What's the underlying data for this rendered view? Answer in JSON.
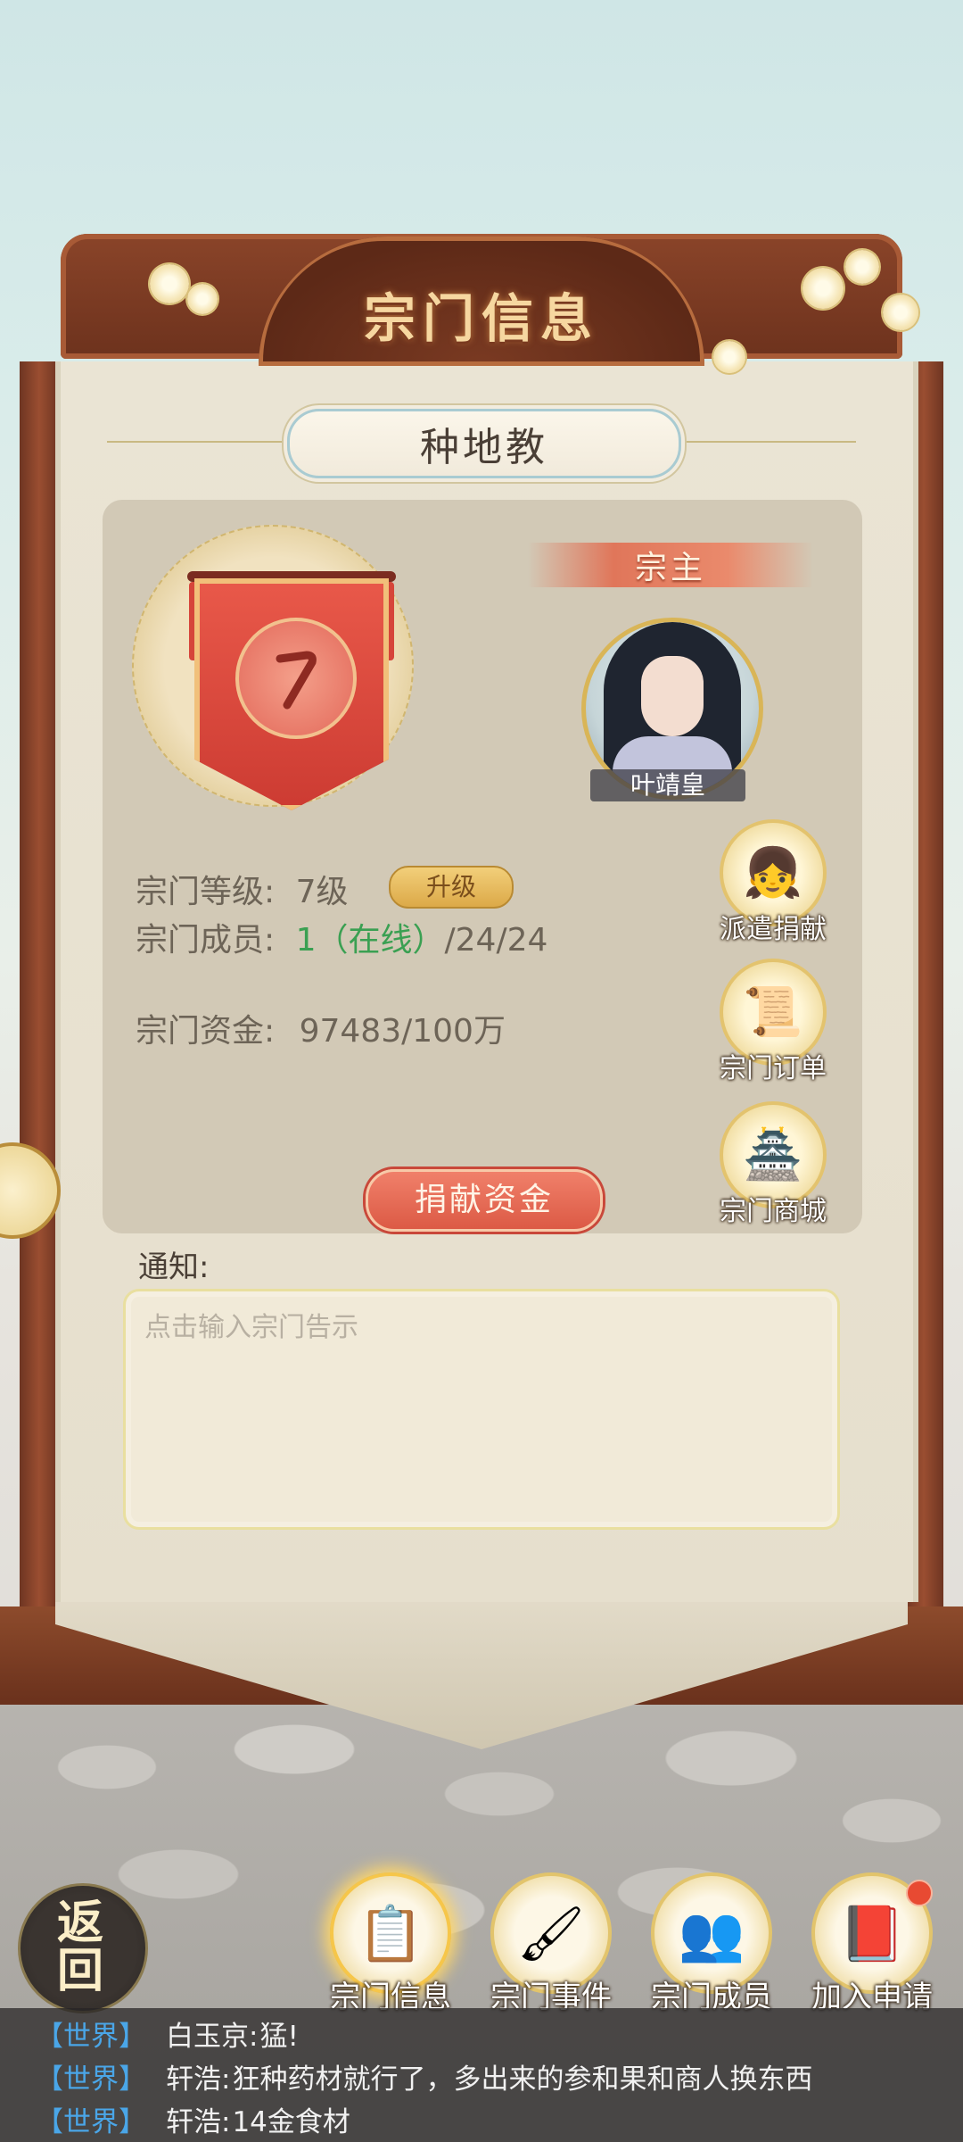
{
  "header": {
    "title": "宗门信息"
  },
  "sect": {
    "name": "种地教"
  },
  "leader": {
    "role_label": "宗主",
    "name": "叶靖皇"
  },
  "info": {
    "level_label": "宗门等级:",
    "level_value": "7级",
    "upgrade_label": "升级",
    "members_label": "宗门成员:",
    "members_online": "1（在线）",
    "members_total": "/24/24",
    "funds_label": "宗门资金:",
    "funds_value": "97483/100万"
  },
  "side_buttons": [
    {
      "label": "派遣捐献",
      "icon": "girl-character-icon"
    },
    {
      "label": "宗门订单",
      "icon": "scroll-icon"
    },
    {
      "label": "宗门商城",
      "icon": "shop-coin-icon"
    }
  ],
  "donate_label": "捐献资金",
  "notice": {
    "label": "通知:",
    "placeholder": "点击输入宗门告示"
  },
  "nav": {
    "back_label": "返回",
    "tabs": [
      {
        "label": "宗门信息",
        "icon": "scroll-info-icon",
        "active": true
      },
      {
        "label": "宗门事件",
        "icon": "brush-scroll-icon",
        "active": false
      },
      {
        "label": "宗门成员",
        "icon": "members-icon",
        "active": false
      },
      {
        "label": "加入申请",
        "icon": "application-book-icon",
        "active": false,
        "badge": true
      }
    ]
  },
  "chat": [
    {
      "channel": "【世界】",
      "name": "白玉京:",
      "text": "猛!"
    },
    {
      "channel": "【世界】",
      "name": "轩浩:",
      "text": "狂种药材就行了，多出来的参和果和商人换东西"
    },
    {
      "channel": "【世界】",
      "name": "轩浩:",
      "text": "14金食材"
    }
  ],
  "colors": {
    "accent_red": "#dc5a45",
    "online_green": "#3aa052",
    "gold": "#dca948",
    "chat_channel": "#4aa6e8"
  }
}
